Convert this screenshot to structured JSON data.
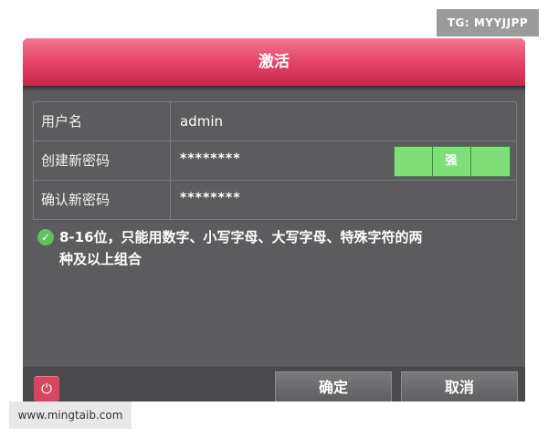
{
  "watermarks": {
    "top_right": "TG: MYYJJPP",
    "bottom_left": "www.mingtaib.com"
  },
  "dialog": {
    "title": "激活",
    "fields": [
      {
        "label": "用户名",
        "value": "admin"
      },
      {
        "label": "创建新密码",
        "value": "********"
      },
      {
        "label": "确认新密码",
        "value": "********"
      }
    ],
    "strength": {
      "label": "强",
      "level": 3,
      "max": 3,
      "color": "#7fe07a"
    },
    "hint_line1": "8-16位，只能用数字、小写字母、大写字母、特殊字符的两",
    "hint_line2": "种及以上组合",
    "buttons": {
      "ok": "确定",
      "cancel": "取消"
    },
    "colors": {
      "title_bar": "#e6486a",
      "panel": "#5c5c5e",
      "check": "#5cc45a"
    },
    "icons": {
      "check": "check-circle-icon",
      "power": "power-icon"
    }
  }
}
